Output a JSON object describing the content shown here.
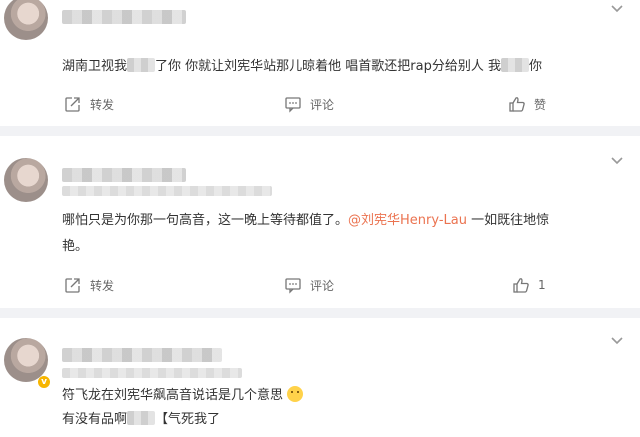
{
  "comments": [
    {
      "content_parts": [
        {
          "text": "湖南卫视我"
        },
        {
          "text": "了你 你就让刘宪华站那儿晾着他 唱首歌还把rap分给别人 我"
        },
        {
          "text": "你"
        }
      ],
      "actions": {
        "repost": "转发",
        "comment": "评论",
        "like": "赞"
      }
    },
    {
      "content_line1": "哪怕只是为你那一句高音，这一晚上等待都值了。",
      "mention": "@刘宪华Henry-Lau",
      "content_tail": " 一如既往地惊",
      "content_line2": "艳。",
      "actions": {
        "repost": "转发",
        "comment": "评论",
        "like": "1"
      }
    },
    {
      "content_line1": "符飞龙在刘宪华飙高音说话是几个意思",
      "content_line2_a": "有没有品啊",
      "content_line2_b": "【气死我了",
      "actions": {}
    }
  ],
  "icons": {
    "menu": "chevron-down-icon",
    "repost": "repost-icon",
    "comment": "comment-icon",
    "like": "thumbs-up-icon",
    "vip": "vip-badge-icon",
    "emoji": "thinking-emoji-icon"
  },
  "colors": {
    "mention": "#eb7350",
    "separator": "#f1f2f5",
    "text": "#333333",
    "action": "#666666"
  }
}
